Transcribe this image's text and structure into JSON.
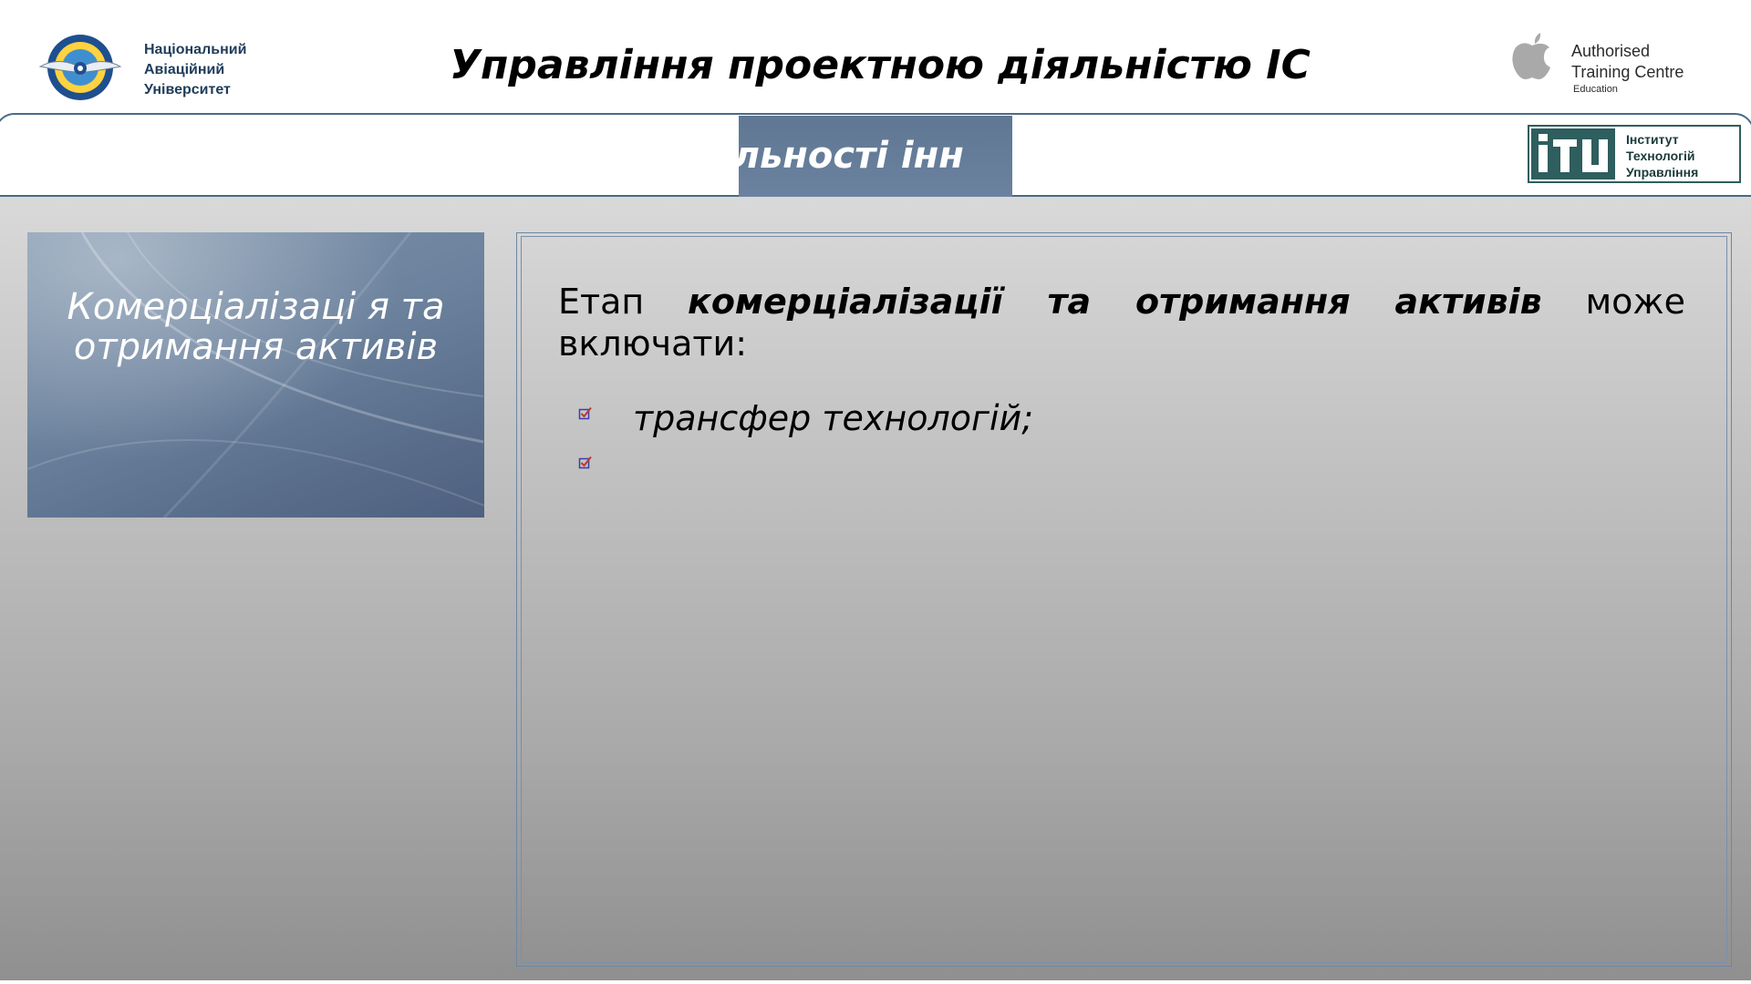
{
  "header": {
    "university_lines": [
      "Національний",
      "Авіаційний",
      "Університет"
    ],
    "title": "Управління проектною діяльністю ІС",
    "apple_badge": {
      "line1": "Authorised",
      "line2": "Training Centre",
      "line3": "Education"
    }
  },
  "section_band": {
    "subtitle_fragment": "яльності інн",
    "itu_logo": {
      "mark": "ітu",
      "lines": [
        "Інститут",
        "Технологій",
        "Управління"
      ]
    }
  },
  "side_panel": {
    "title": "Комерціалізаці я та отримання активів"
  },
  "body": {
    "intro_prefix": "Етап ",
    "intro_emphasis": "комерціалізації та отримання активів",
    "intro_suffix": " може включати:",
    "bullets": [
      {
        "text": "трансфер технологій;"
      },
      {
        "text": ""
      }
    ]
  },
  "colors": {
    "band_border": "#4a6a88",
    "subtitle_box": "#6b82a0",
    "bullet_check": "#c0392b",
    "bullet_box": "#3b3bb0",
    "itu_green": "#2e5e5e"
  },
  "icons": [
    "nau-emblem-icon",
    "apple-logo-icon",
    "itu-logo-icon",
    "checkbox-bullet-icon"
  ]
}
